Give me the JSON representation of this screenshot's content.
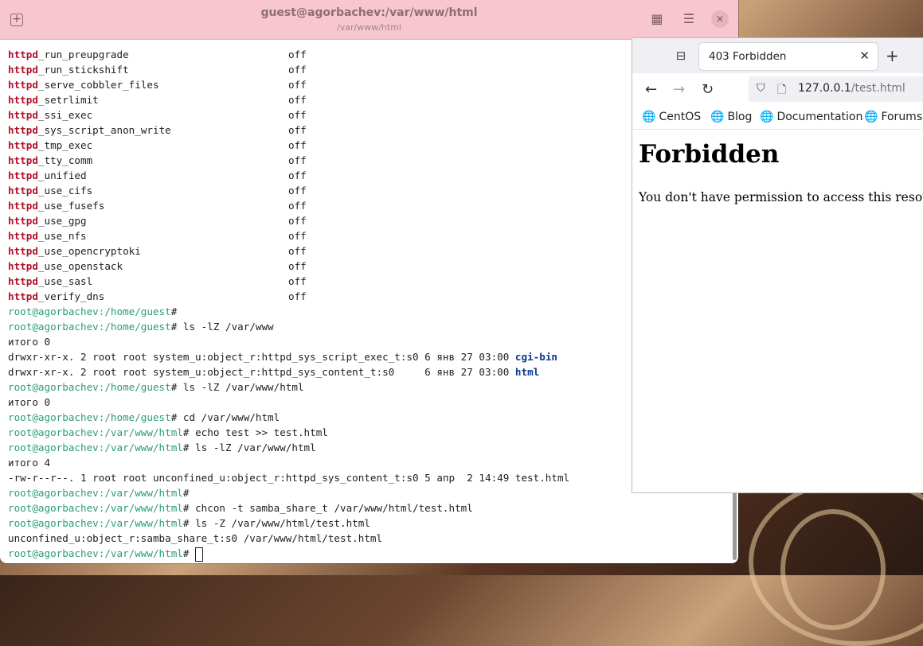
{
  "terminal": {
    "title": "guest@agorbachev:/var/www/html",
    "subtitle": "/var/www/html",
    "booleans": [
      {
        "prefix": "httpd",
        "name": "_run_preupgrade",
        "value": "off"
      },
      {
        "prefix": "httpd",
        "name": "_run_stickshift",
        "value": "off"
      },
      {
        "prefix": "httpd",
        "name": "_serve_cobbler_files",
        "value": "off"
      },
      {
        "prefix": "httpd",
        "name": "_setrlimit",
        "value": "off"
      },
      {
        "prefix": "httpd",
        "name": "_ssi_exec",
        "value": "off"
      },
      {
        "prefix": "httpd",
        "name": "_sys_script_anon_write",
        "value": "off"
      },
      {
        "prefix": "httpd",
        "name": "_tmp_exec",
        "value": "off"
      },
      {
        "prefix": "httpd",
        "name": "_tty_comm",
        "value": "off"
      },
      {
        "prefix": "httpd",
        "name": "_unified",
        "value": "off"
      },
      {
        "prefix": "httpd",
        "name": "_use_cifs",
        "value": "off"
      },
      {
        "prefix": "httpd",
        "name": "_use_fusefs",
        "value": "off"
      },
      {
        "prefix": "httpd",
        "name": "_use_gpg",
        "value": "off"
      },
      {
        "prefix": "httpd",
        "name": "_use_nfs",
        "value": "off"
      },
      {
        "prefix": "httpd",
        "name": "_use_opencryptoki",
        "value": "off"
      },
      {
        "prefix": "httpd",
        "name": "_use_openstack",
        "value": "off"
      },
      {
        "prefix": "httpd",
        "name": "_use_sasl",
        "value": "off"
      },
      {
        "prefix": "httpd",
        "name": "_verify_dns",
        "value": "off"
      }
    ],
    "prompt_user": "root@agorbachev",
    "prompt_home": ":/home/guest",
    "prompt_html": ":/var/www/html",
    "prompt_symbol": "#",
    "cmd1": " ls -lZ /var/www",
    "out_total0": "итого 0",
    "dir_line1": "drwxr-xr-x. 2 root root system_u:object_r:httpd_sys_script_exec_t:s0 6 янв 27 03:00 ",
    "dir_name1": "cgi-bin",
    "dir_line2": "drwxr-xr-x. 2 root root system_u:object_r:httpd_sys_content_t:s0     6 янв 27 03:00 ",
    "dir_name2": "html",
    "cmd2": " ls -lZ /var/www/html",
    "out_total0b": "итого 0",
    "cmd3": " cd /var/www/html",
    "cmd4": " echo test >> test.html",
    "cmd5": " ls -lZ /var/www/html",
    "out_total4": "итого 4",
    "file_line": "-rw-r--r--. 1 root root unconfined_u:object_r:httpd_sys_content_t:s0 5 апр  2 14:49 test.html",
    "cmd6": " chcon -t samba_share_t /var/www/html/test.html",
    "cmd7": " ls -Z /var/www/html/test.html",
    "ctx_line": "unconfined_u:object_r:samba_share_t:s0 /var/www/html/test.html"
  },
  "browser": {
    "tab_title": "403 Forbidden",
    "url_host": "127.0.0.1",
    "url_rest": "/test.html",
    "bookmarks": [
      "CentOS",
      "Blog",
      "Documentation",
      "Forums"
    ],
    "heading": "Forbidden",
    "message": "You don't have permission to access this resour"
  }
}
